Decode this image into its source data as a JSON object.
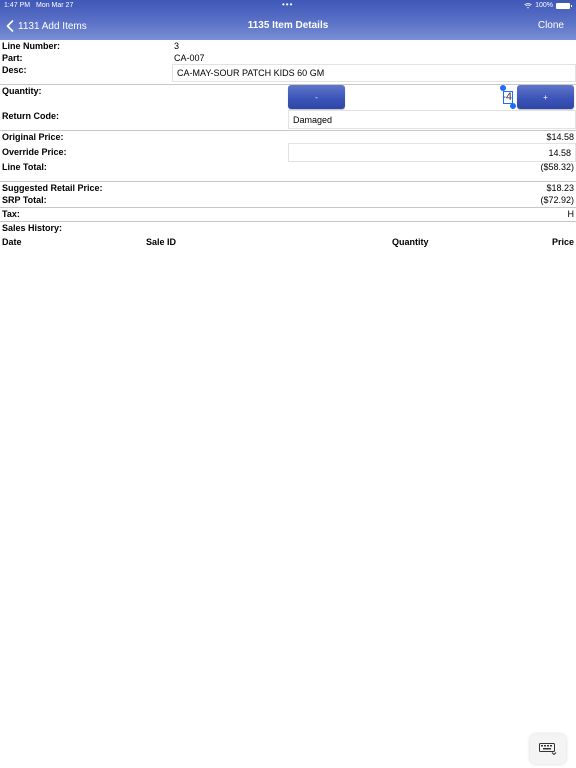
{
  "status_bar": {
    "time": "1:47 PM",
    "date": "Mon Mar 27",
    "dots": "•••",
    "battery_pct": "100%"
  },
  "nav": {
    "back_label": "1131 Add Items",
    "title": "1135 Item Details",
    "clone_label": "Clone"
  },
  "fields": {
    "line_number_label": "Line Number:",
    "line_number_value": "3",
    "part_label": "Part:",
    "part_value": "CA-007",
    "desc_label": "Desc:",
    "desc_value": "CA-MAY-SOUR PATCH KIDS 60 GM",
    "quantity_label": "Quantity:",
    "quantity_value": "-4",
    "minus_label": "-",
    "plus_label": "+",
    "return_code_label": "Return Code:",
    "return_code_value": "Damaged",
    "original_price_label": "Original Price:",
    "original_price_value": "$14.58",
    "override_price_label": "Override Price:",
    "override_price_value": "14.58",
    "line_total_label": "Line Total:",
    "line_total_value": "($58.32)",
    "srp_label": "Suggested Retail Price:",
    "srp_value": "$18.23",
    "srp_total_label": "SRP Total:",
    "srp_total_value": "($72.92)",
    "tax_label": "Tax:",
    "tax_value": "H"
  },
  "sales_history": {
    "title": "Sales History:",
    "columns": [
      "Date",
      "Sale ID",
      "Quantity",
      "Price"
    ],
    "rows": []
  },
  "colors": {
    "nav_blue": "#4a62be",
    "button_blue": "#3c55b8",
    "cursor_blue": "#1e6ef5"
  }
}
